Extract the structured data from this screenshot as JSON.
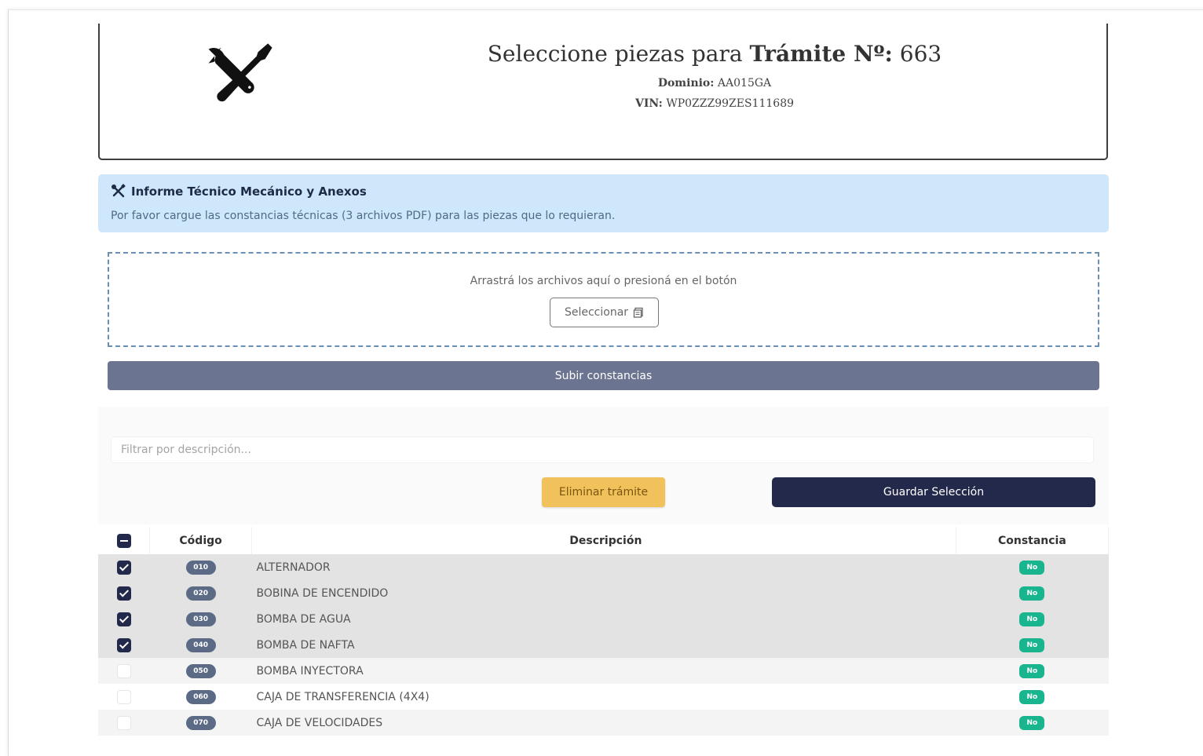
{
  "header": {
    "title_prefix": "Seleccione piezas para",
    "title_bold": "Trámite Nº:",
    "tramite_number": "663",
    "dominio_label": "Dominio:",
    "dominio_value": "AA015GA",
    "vin_label": "VIN:",
    "vin_value": "WP0ZZZ99ZES111689",
    "logo_icon": "tools-icon"
  },
  "info": {
    "title": "Informe Técnico Mecánico y Anexos",
    "text": "Por favor cargue las constancias técnicas (3 archivos PDF) para las piezas que lo requieran.",
    "icon": "tools-icon",
    "background": "#cfe7fb"
  },
  "dropzone": {
    "hint": "Arrastrá los archivos aquí o presioná en el botón",
    "select_label": "Seleccionar"
  },
  "upload_label": "Subir constancias",
  "filter": {
    "placeholder": "Filtrar por descripción..."
  },
  "actions": {
    "delete_label": "Eliminar trámite",
    "save_label": "Guardar Selección"
  },
  "table": {
    "headers": {
      "code": "Código",
      "description": "Descripción",
      "constancia": "Constancia"
    },
    "rows": [
      {
        "code": "010",
        "description": "ALTERNADOR",
        "constancia": "No",
        "checked": true
      },
      {
        "code": "020",
        "description": "BOBINA DE ENCENDIDO",
        "constancia": "No",
        "checked": true
      },
      {
        "code": "030",
        "description": "BOMBA DE AGUA",
        "constancia": "No",
        "checked": true
      },
      {
        "code": "040",
        "description": "BOMBA DE NAFTA",
        "constancia": "No",
        "checked": true
      },
      {
        "code": "050",
        "description": "BOMBA INYECTORA",
        "constancia": "No",
        "checked": false
      },
      {
        "code": "060",
        "description": "CAJA DE TRANSFERENCIA (4X4)",
        "constancia": "No",
        "checked": false
      },
      {
        "code": "070",
        "description": "CAJA DE VELOCIDADES",
        "constancia": "No",
        "checked": false
      }
    ]
  },
  "colors": {
    "primary": "#23294a",
    "warning": "#f1c25c",
    "success": "#19b58e",
    "secondary": "#6b7591"
  }
}
